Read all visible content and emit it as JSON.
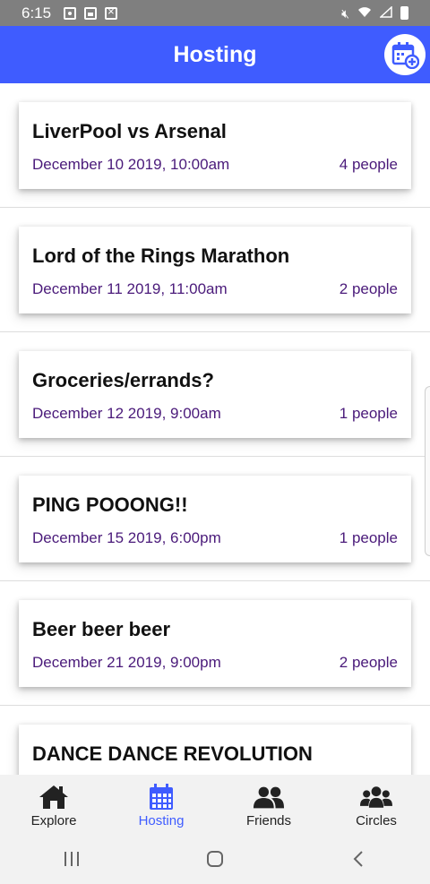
{
  "status_bar": {
    "time": "6:15"
  },
  "header": {
    "title": "Hosting"
  },
  "events": [
    {
      "title": "LiverPool vs Arsenal",
      "date": "December 10 2019, 10:00am",
      "people": "4 people"
    },
    {
      "title": "Lord of the Rings Marathon",
      "date": "December 11 2019, 11:00am",
      "people": "2 people"
    },
    {
      "title": "Groceries/errands?",
      "date": "December 12 2019, 9:00am",
      "people": "1 people"
    },
    {
      "title": "PING POOONG!!",
      "date": "December 15 2019, 6:00pm",
      "people": "1 people"
    },
    {
      "title": "Beer beer beer",
      "date": "December 21 2019, 9:00pm",
      "people": "2 people"
    },
    {
      "title": "DANCE DANCE REVOLUTION",
      "date": "",
      "people": ""
    }
  ],
  "tabs": [
    {
      "label": "Explore",
      "icon": "home-icon"
    },
    {
      "label": "Hosting",
      "icon": "calendar-icon",
      "active": true
    },
    {
      "label": "Friends",
      "icon": "friends-icon"
    },
    {
      "label": "Circles",
      "icon": "group-icon"
    }
  ],
  "colors": {
    "primary": "#3f5cff",
    "meta_text": "#4a1a7a",
    "status_bar": "#7f7f7f"
  }
}
